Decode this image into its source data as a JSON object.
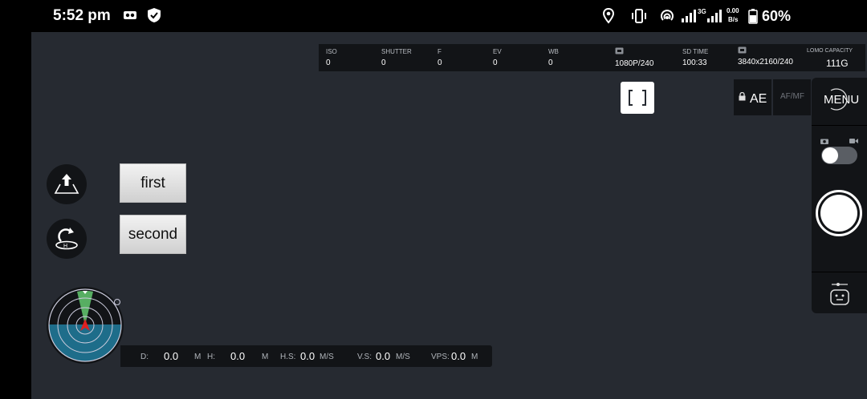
{
  "status_bar": {
    "time": "5:52 pm",
    "network_gen": "3G",
    "data_rate_value": "0.00",
    "data_rate_unit": "B/s",
    "battery": "60%",
    "icons": [
      "vr-headset-icon",
      "shield-icon",
      "location-icon",
      "vibrate-icon",
      "hotspot-icon",
      "signal-icon",
      "signal-icon",
      "battery-icon"
    ]
  },
  "camera_info": {
    "iso_label": "ISO",
    "iso_value": "0",
    "shutter_label": "SHUTTER",
    "shutter_value": "0",
    "f_label": "F",
    "f_value": "0",
    "ev_label": "EV",
    "ev_value": "0",
    "wb_label": "WB",
    "wb_value": "0",
    "video_format": "1080P/240",
    "sd_time_label": "SD TIME",
    "sd_time_value": "100:33",
    "photo_resolution": "3840x2160/240",
    "capacity_label": "LOMO CAPACITY",
    "capacity_value": "111G"
  },
  "exposure": {
    "ae_label": "AE",
    "afmf_label": "AF/MF"
  },
  "menu_label": "MENU",
  "buttons": {
    "first": "first",
    "second": "second"
  },
  "telemetry": {
    "d_label": "D:",
    "d_value": "0.0",
    "d_unit": "M",
    "h_label": "H:",
    "h_value": "0.0",
    "h_unit": "M",
    "hs_label": "H.S:",
    "hs_value": "0.0",
    "hs_unit": "M/S",
    "vs_label": "V.S:",
    "vs_value": "0.0",
    "vs_unit": "M/S",
    "vps_label": "VPS:",
    "vps_value": "0.0",
    "vps_unit": "M"
  },
  "colors": {
    "background": "#262a31",
    "panel": "#121417",
    "radar_sea": "#1e6d8a",
    "radar_beam": "#5fbf6a",
    "aircraft": "#e02020"
  }
}
